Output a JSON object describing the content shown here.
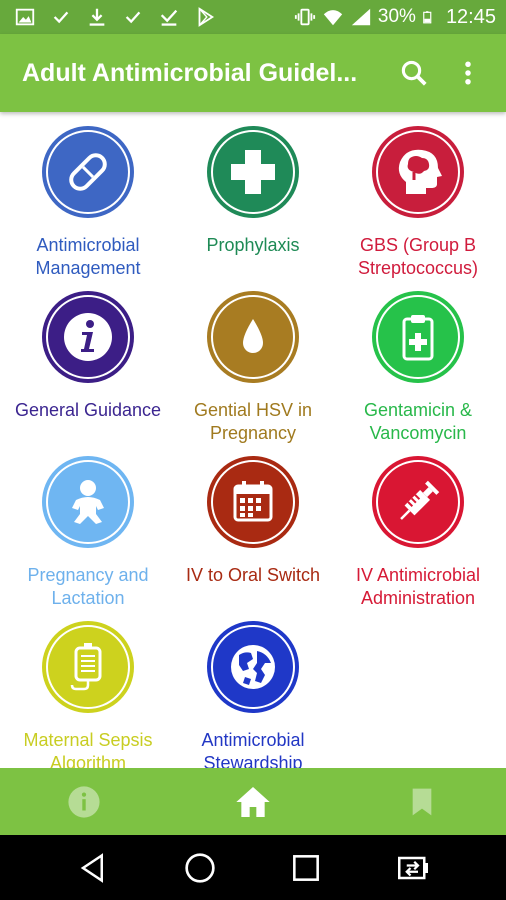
{
  "status_bar": {
    "battery": "30%",
    "time": "12:45"
  },
  "app_bar": {
    "title": "Adult Antimicrobial Guidel..."
  },
  "tiles": [
    {
      "label": "Antimicrobial Management",
      "color": "#3e67c4",
      "text_color": "#2f5bbf",
      "icon": "capsule-icon"
    },
    {
      "label": "Prophylaxis",
      "color": "#1f8a58",
      "text_color": "#1e8a55",
      "icon": "medical-cross-icon"
    },
    {
      "label": "GBS (Group B Streptococcus)",
      "color": "#c81e3c",
      "text_color": "#d01b3c",
      "icon": "head-brain-icon"
    },
    {
      "label": "General Guidance",
      "color": "#3c1e86",
      "text_color": "#3b2590",
      "icon": "info-icon"
    },
    {
      "label": "Gential HSV in Pregnancy",
      "color": "#a87c22",
      "text_color": "#a07a1f",
      "icon": "drop-icon"
    },
    {
      "label": "Gentamicin & Vancomycin",
      "color": "#26c24a",
      "text_color": "#28b84a",
      "icon": "clipboard-icon"
    },
    {
      "label": "Pregnancy and Lactation",
      "color": "#6fb6f2",
      "text_color": "#6eb1ec",
      "icon": "baby-icon"
    },
    {
      "label": "IV to Oral Switch",
      "color": "#a92a12",
      "text_color": "#a82a12",
      "icon": "calendar-icon"
    },
    {
      "label": "IV Antimicrobial Administration",
      "color": "#d91633",
      "text_color": "#d61a36",
      "icon": "syringe-icon"
    },
    {
      "label": "Maternal Sepsis Algorithm",
      "color": "#cdd21e",
      "text_color": "#c8cd22",
      "icon": "iv-bag-icon"
    },
    {
      "label": "Antimicrobial Stewardship",
      "color": "#1f38c8",
      "text_color": "#2237c4",
      "icon": "globe-icon"
    }
  ],
  "colors": {
    "status_bar": "#67a93c",
    "app_bar": "#7dc243",
    "bottom_nav": "#7dc243"
  }
}
